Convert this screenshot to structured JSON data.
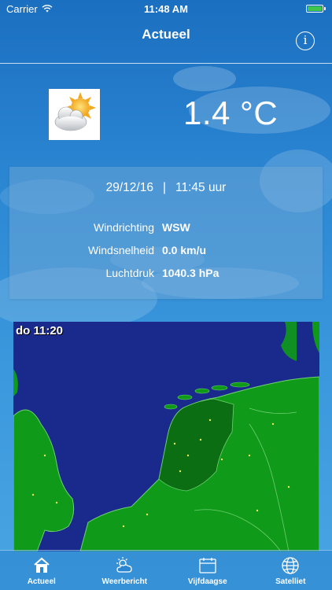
{
  "status_bar": {
    "carrier": "Carrier",
    "time": "11:48 AM",
    "battery_level": 1.0
  },
  "nav": {
    "title": "Actueel",
    "info_label": "i"
  },
  "current": {
    "icon": "partly-cloudy-sun-icon",
    "temperature": "1.4 °C",
    "date": "29/12/16",
    "separator": "|",
    "time": "11:45 uur",
    "rows": [
      {
        "label": "Windrichting",
        "value": "WSW"
      },
      {
        "label": "Windsnelheid",
        "value": "0.0 km/u"
      },
      {
        "label": "Luchtdruk",
        "value": "1040.3 hPa"
      }
    ]
  },
  "radar": {
    "timestamp": "do 11:20",
    "colors": {
      "sea": "#1a2a8c",
      "land": "#0f9a1a",
      "land_dark": "#0b6e13"
    }
  },
  "tabs": [
    {
      "label": "Actueel",
      "icon": "home-icon",
      "active": true
    },
    {
      "label": "Weerbericht",
      "icon": "cloud-sun-icon",
      "active": false
    },
    {
      "label": "Vijfdaagse",
      "icon": "calendar-icon",
      "active": false
    },
    {
      "label": "Satelliet",
      "icon": "globe-icon",
      "active": false
    }
  ]
}
